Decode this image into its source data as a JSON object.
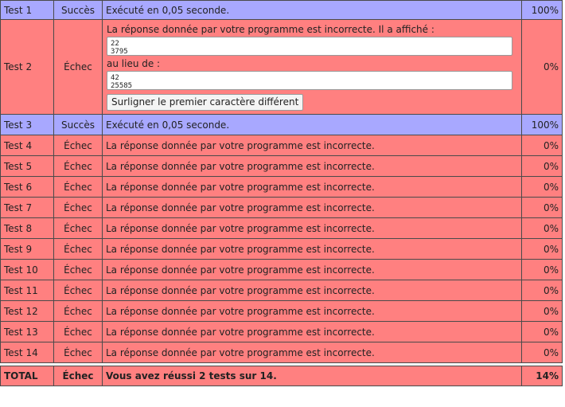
{
  "rows": [
    {
      "name": "Test 1",
      "status": "Succès",
      "message": "Exécuté en 0,05 seconde.",
      "score": "100%",
      "ok": true
    },
    {
      "name": "Test 2",
      "status": "Échec",
      "message": "La réponse donnée par votre programme est incorrecte. Il a affiché :",
      "output": [
        "22",
        "3795"
      ],
      "expected_label": "au lieu de :",
      "expected": [
        "42",
        "25585"
      ],
      "button": "Surligner le premier caractère différent",
      "score": "0%",
      "ok": false
    },
    {
      "name": "Test 3",
      "status": "Succès",
      "message": "Exécuté en 0,05 seconde.",
      "score": "100%",
      "ok": true
    },
    {
      "name": "Test 4",
      "status": "Échec",
      "message": "La réponse donnée par votre programme est incorrecte.",
      "score": "0%",
      "ok": false
    },
    {
      "name": "Test 5",
      "status": "Échec",
      "message": "La réponse donnée par votre programme est incorrecte.",
      "score": "0%",
      "ok": false
    },
    {
      "name": "Test 6",
      "status": "Échec",
      "message": "La réponse donnée par votre programme est incorrecte.",
      "score": "0%",
      "ok": false
    },
    {
      "name": "Test 7",
      "status": "Échec",
      "message": "La réponse donnée par votre programme est incorrecte.",
      "score": "0%",
      "ok": false
    },
    {
      "name": "Test 8",
      "status": "Échec",
      "message": "La réponse donnée par votre programme est incorrecte.",
      "score": "0%",
      "ok": false
    },
    {
      "name": "Test 9",
      "status": "Échec",
      "message": "La réponse donnée par votre programme est incorrecte.",
      "score": "0%",
      "ok": false
    },
    {
      "name": "Test 10",
      "status": "Échec",
      "message": "La réponse donnée par votre programme est incorrecte.",
      "score": "0%",
      "ok": false
    },
    {
      "name": "Test 11",
      "status": "Échec",
      "message": "La réponse donnée par votre programme est incorrecte.",
      "score": "0%",
      "ok": false
    },
    {
      "name": "Test 12",
      "status": "Échec",
      "message": "La réponse donnée par votre programme est incorrecte.",
      "score": "0%",
      "ok": false
    },
    {
      "name": "Test 13",
      "status": "Échec",
      "message": "La réponse donnée par votre programme est incorrecte.",
      "score": "0%",
      "ok": false
    },
    {
      "name": "Test 14",
      "status": "Échec",
      "message": "La réponse donnée par votre programme est incorrecte.",
      "score": "0%",
      "ok": false
    }
  ],
  "total": {
    "name": "TOTAL",
    "status": "Échec",
    "message": "Vous avez réussi 2 tests sur 14.",
    "score": "14%"
  },
  "colors": {
    "success": "#a8a8ff",
    "failure": "#ff8080"
  }
}
